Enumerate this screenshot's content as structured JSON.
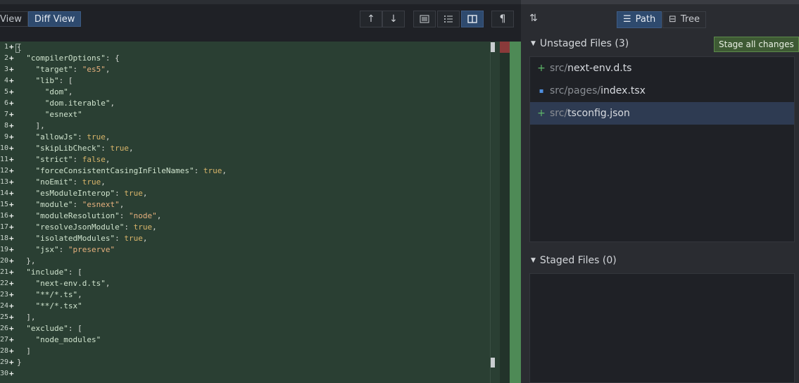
{
  "toolbar": {
    "tabs": [
      {
        "label": "View",
        "active": false
      },
      {
        "label": "Diff View",
        "active": true
      }
    ],
    "icons": [
      "arrow-up-icon",
      "arrow-down-icon",
      "inline-view-icon",
      "list-view-icon",
      "split-view-icon",
      "pilcrow-icon"
    ]
  },
  "editor": {
    "lines": [
      {
        "n": "1",
        "parts": [
          [
            "p",
            "{"
          ]
        ]
      },
      {
        "n": "2",
        "parts": [
          [
            "p",
            "  "
          ],
          [
            "k",
            "\"compilerOptions\""
          ],
          [
            "p",
            ": {"
          ]
        ]
      },
      {
        "n": "3",
        "parts": [
          [
            "p",
            "    "
          ],
          [
            "k",
            "\"target\""
          ],
          [
            "p",
            ": "
          ],
          [
            "s",
            "\"es5\""
          ],
          [
            "p",
            ","
          ]
        ]
      },
      {
        "n": "4",
        "parts": [
          [
            "p",
            "    "
          ],
          [
            "k",
            "\"lib\""
          ],
          [
            "p",
            ": ["
          ]
        ]
      },
      {
        "n": "5",
        "parts": [
          [
            "p",
            "      "
          ],
          [
            "k",
            "\"dom\""
          ],
          [
            "p",
            ","
          ]
        ]
      },
      {
        "n": "6",
        "parts": [
          [
            "p",
            "      "
          ],
          [
            "k",
            "\"dom.iterable\""
          ],
          [
            "p",
            ","
          ]
        ]
      },
      {
        "n": "7",
        "parts": [
          [
            "p",
            "      "
          ],
          [
            "k",
            "\"esnext\""
          ]
        ]
      },
      {
        "n": "8",
        "parts": [
          [
            "p",
            "    ],"
          ]
        ]
      },
      {
        "n": "9",
        "parts": [
          [
            "p",
            "    "
          ],
          [
            "k",
            "\"allowJs\""
          ],
          [
            "p",
            ": "
          ],
          [
            "b",
            "true"
          ],
          [
            "p",
            ","
          ]
        ]
      },
      {
        "n": "10",
        "parts": [
          [
            "p",
            "    "
          ],
          [
            "k",
            "\"skipLibCheck\""
          ],
          [
            "p",
            ": "
          ],
          [
            "b",
            "true"
          ],
          [
            "p",
            ","
          ]
        ]
      },
      {
        "n": "11",
        "parts": [
          [
            "p",
            "    "
          ],
          [
            "k",
            "\"strict\""
          ],
          [
            "p",
            ": "
          ],
          [
            "b",
            "false"
          ],
          [
            "p",
            ","
          ]
        ]
      },
      {
        "n": "12",
        "parts": [
          [
            "p",
            "    "
          ],
          [
            "k",
            "\"forceConsistentCasingInFileNames\""
          ],
          [
            "p",
            ": "
          ],
          [
            "b",
            "true"
          ],
          [
            "p",
            ","
          ]
        ]
      },
      {
        "n": "13",
        "parts": [
          [
            "p",
            "    "
          ],
          [
            "k",
            "\"noEmit\""
          ],
          [
            "p",
            ": "
          ],
          [
            "b",
            "true"
          ],
          [
            "p",
            ","
          ]
        ]
      },
      {
        "n": "14",
        "parts": [
          [
            "p",
            "    "
          ],
          [
            "k",
            "\"esModuleInterop\""
          ],
          [
            "p",
            ": "
          ],
          [
            "b",
            "true"
          ],
          [
            "p",
            ","
          ]
        ]
      },
      {
        "n": "15",
        "parts": [
          [
            "p",
            "    "
          ],
          [
            "k",
            "\"module\""
          ],
          [
            "p",
            ": "
          ],
          [
            "s",
            "\"esnext\""
          ],
          [
            "p",
            ","
          ]
        ]
      },
      {
        "n": "16",
        "parts": [
          [
            "p",
            "    "
          ],
          [
            "k",
            "\"moduleResolution\""
          ],
          [
            "p",
            ": "
          ],
          [
            "s",
            "\"node\""
          ],
          [
            "p",
            ","
          ]
        ]
      },
      {
        "n": "17",
        "parts": [
          [
            "p",
            "    "
          ],
          [
            "k",
            "\"resolveJsonModule\""
          ],
          [
            "p",
            ": "
          ],
          [
            "b",
            "true"
          ],
          [
            "p",
            ","
          ]
        ]
      },
      {
        "n": "18",
        "parts": [
          [
            "p",
            "    "
          ],
          [
            "k",
            "\"isolatedModules\""
          ],
          [
            "p",
            ": "
          ],
          [
            "b",
            "true"
          ],
          [
            "p",
            ","
          ]
        ]
      },
      {
        "n": "19",
        "parts": [
          [
            "p",
            "    "
          ],
          [
            "k",
            "\"jsx\""
          ],
          [
            "p",
            ": "
          ],
          [
            "s",
            "\"preserve\""
          ]
        ]
      },
      {
        "n": "20",
        "parts": [
          [
            "p",
            "  },"
          ]
        ]
      },
      {
        "n": "21",
        "parts": [
          [
            "p",
            "  "
          ],
          [
            "k",
            "\"include\""
          ],
          [
            "p",
            ": ["
          ]
        ]
      },
      {
        "n": "22",
        "parts": [
          [
            "p",
            "    "
          ],
          [
            "k",
            "\"next-env.d.ts\""
          ],
          [
            "p",
            ","
          ]
        ]
      },
      {
        "n": "23",
        "parts": [
          [
            "p",
            "    "
          ],
          [
            "k",
            "\"**/*.ts\""
          ],
          [
            "p",
            ","
          ]
        ]
      },
      {
        "n": "24",
        "parts": [
          [
            "p",
            "    "
          ],
          [
            "k",
            "\"**/*.tsx\""
          ]
        ]
      },
      {
        "n": "25",
        "parts": [
          [
            "p",
            "  ],"
          ]
        ]
      },
      {
        "n": "26",
        "parts": [
          [
            "p",
            "  "
          ],
          [
            "k",
            "\"exclude\""
          ],
          [
            "p",
            ": ["
          ]
        ]
      },
      {
        "n": "27",
        "parts": [
          [
            "p",
            "    "
          ],
          [
            "k",
            "\"node_modules\""
          ]
        ]
      },
      {
        "n": "28",
        "parts": [
          [
            "p",
            "  ]"
          ]
        ]
      },
      {
        "n": "29",
        "parts": [
          [
            "p",
            "}"
          ]
        ]
      },
      {
        "n": "30",
        "parts": []
      }
    ]
  },
  "panel": {
    "path_label": "Path",
    "tree_label": "Tree",
    "unstaged_title": "Unstaged Files (3)",
    "stage_all_label": "Stage all changes",
    "unstaged_files": [
      {
        "dir": "src/",
        "name": "next-env.d.ts",
        "status": "added",
        "icon": "+"
      },
      {
        "dir": "src/pages/",
        "name": "index.tsx",
        "status": "modified",
        "icon": "▪"
      },
      {
        "dir": "src/",
        "name": "tsconfig.json",
        "status": "added",
        "icon": "+"
      }
    ],
    "staged_title": "Staged Files (0)"
  },
  "colors": {
    "added": "#5fb86a",
    "modified": "#4f8fe0",
    "accent": "#2e4a6e"
  }
}
